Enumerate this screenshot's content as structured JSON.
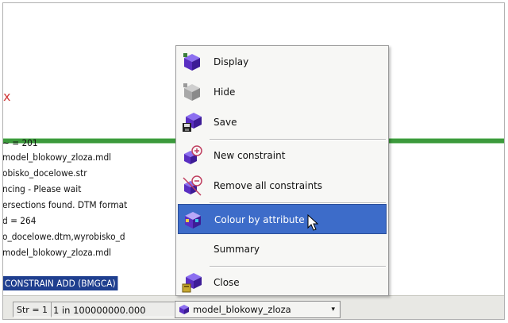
{
  "log_lines": [
    "~ = 201",
    "model_blokowy_zloza.mdl",
    "obisko_docelowe.str",
    "ncing - Please wait",
    "ersections found. DTM format",
    "d = 264",
    "o_docelowe.dtm,wyrobisko_d",
    "model_blokowy_zloza.mdl"
  ],
  "command_line": "CONSTRAIN ADD (BMGCA)",
  "left_mark": "x",
  "statusbar": {
    "str_field": "Str = 1",
    "scale_field": "1 in 100000000.000",
    "object_dropdown": "model_blokowy_zloza",
    "dropdown_arrow": "▾"
  },
  "context_menu": {
    "items": [
      {
        "label": "Display",
        "icon": "block-model-display-icon"
      },
      {
        "label": "Hide",
        "icon": "block-model-hide-icon"
      },
      {
        "label": "Save",
        "icon": "block-model-save-icon"
      },
      {
        "label": "New constraint",
        "icon": "new-constraint-icon"
      },
      {
        "label": "Remove all constraints",
        "icon": "remove-constraints-icon"
      },
      {
        "label": "Colour by attribute",
        "icon": "colour-by-attribute-icon"
      },
      {
        "label": "Summary",
        "icon": ""
      },
      {
        "label": "Close",
        "icon": "close-model-icon"
      }
    ],
    "selected_index": 5
  },
  "colors": {
    "selection": "#3d6cc9",
    "command_highlight": "#1f3f8f",
    "model_purple": "#5a2fc2",
    "green_bar": "#3c9a3c"
  }
}
